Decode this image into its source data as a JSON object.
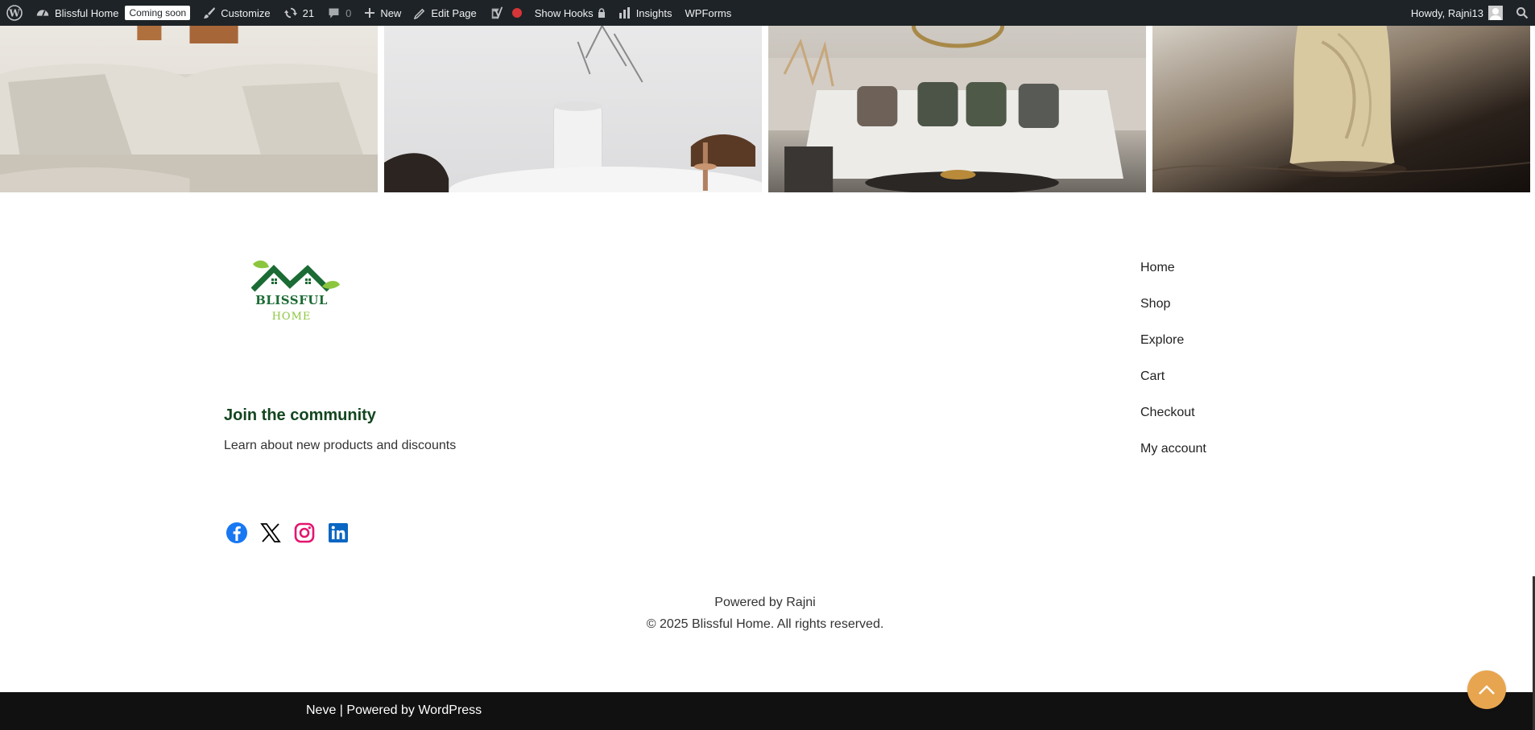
{
  "adminbar": {
    "site_name": "Blissful Home",
    "coming_soon": "Coming soon",
    "customize": "Customize",
    "updates_count": "21",
    "comments_count": "0",
    "new_label": "New",
    "edit_page": "Edit Page",
    "show_hooks": "Show Hooks",
    "insights": "Insights",
    "wpforms": "WPForms",
    "howdy": "Howdy, Rajni13"
  },
  "logo": {
    "line1": "BLISSFUL",
    "line2": "HOME",
    "colors": {
      "dark_green": "#1b6b34",
      "light_green": "#8cc63f"
    }
  },
  "community": {
    "title": "Join the community",
    "subtitle": "Learn about new products and discounts"
  },
  "social": [
    {
      "icon": "facebook-icon",
      "color": "#1877f2"
    },
    {
      "icon": "x-twitter-icon",
      "color": "#000000"
    },
    {
      "icon": "instagram-icon",
      "color": "#e4166f"
    },
    {
      "icon": "linkedin-icon",
      "color": "#0a66c2"
    }
  ],
  "footer_nav": [
    {
      "label": "Home"
    },
    {
      "label": "Shop"
    },
    {
      "label": "Explore"
    },
    {
      "label": "Cart"
    },
    {
      "label": "Checkout"
    },
    {
      "label": "My account"
    }
  ],
  "footer_text": {
    "powered_by": "Powered by Rajni",
    "copyright": "© 2025 Blissful Home. All rights reserved."
  },
  "bottombar": {
    "theme": "Neve",
    "separator": " | Powered by ",
    "platform": "WordPress"
  },
  "colors": {
    "adminbar_bg": "#1d2327",
    "community_title": "#13461f",
    "scroll_top_bg": "#e8a54f",
    "bottombar_bg": "#111111"
  }
}
